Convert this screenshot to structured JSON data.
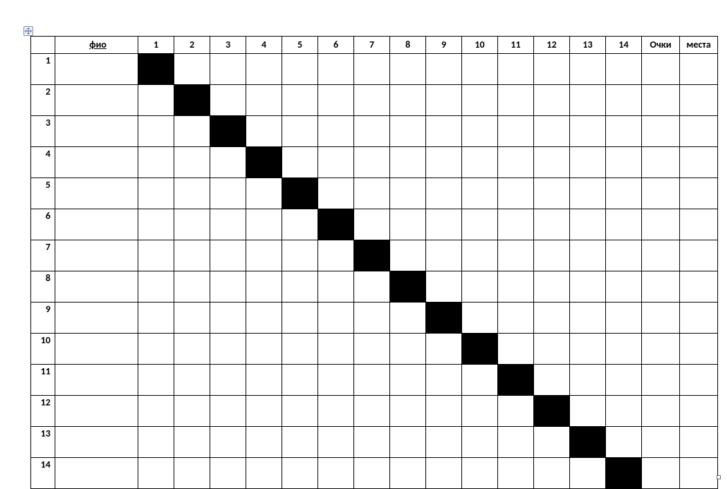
{
  "header": {
    "rownum": "",
    "name": "фио",
    "columns": [
      "1",
      "2",
      "3",
      "4",
      "5",
      "6",
      "7",
      "8",
      "9",
      "10",
      "11",
      "12",
      "13",
      "14"
    ],
    "points": "Очки",
    "place": "места"
  },
  "rows": [
    {
      "num": "1",
      "name": "",
      "cells": [
        "",
        "",
        "",
        "",
        "",
        "",
        "",
        "",
        "",
        "",
        "",
        "",
        "",
        ""
      ],
      "diag": 0,
      "points": "",
      "place": ""
    },
    {
      "num": "2",
      "name": "",
      "cells": [
        "",
        "",
        "",
        "",
        "",
        "",
        "",
        "",
        "",
        "",
        "",
        "",
        "",
        ""
      ],
      "diag": 1,
      "points": "",
      "place": ""
    },
    {
      "num": "3",
      "name": "",
      "cells": [
        "",
        "",
        "",
        "",
        "",
        "",
        "",
        "",
        "",
        "",
        "",
        "",
        "",
        ""
      ],
      "diag": 2,
      "points": "",
      "place": ""
    },
    {
      "num": "4",
      "name": "",
      "cells": [
        "",
        "",
        "",
        "",
        "",
        "",
        "",
        "",
        "",
        "",
        "",
        "",
        "",
        ""
      ],
      "diag": 3,
      "points": "",
      "place": ""
    },
    {
      "num": "5",
      "name": "",
      "cells": [
        "",
        "",
        "",
        "",
        "",
        "",
        "",
        "",
        "",
        "",
        "",
        "",
        "",
        ""
      ],
      "diag": 4,
      "points": "",
      "place": ""
    },
    {
      "num": "6",
      "name": "",
      "cells": [
        "",
        "",
        "",
        "",
        "",
        "",
        "",
        "",
        "",
        "",
        "",
        "",
        "",
        ""
      ],
      "diag": 5,
      "points": "",
      "place": ""
    },
    {
      "num": "7",
      "name": "",
      "cells": [
        "",
        "",
        "",
        "",
        "",
        "",
        "",
        "",
        "",
        "",
        "",
        "",
        "",
        ""
      ],
      "diag": 6,
      "points": "",
      "place": ""
    },
    {
      "num": "8",
      "name": "",
      "cells": [
        "",
        "",
        "",
        "",
        "",
        "",
        "",
        "",
        "",
        "",
        "",
        "",
        "",
        ""
      ],
      "diag": 7,
      "points": "",
      "place": ""
    },
    {
      "num": "9",
      "name": "",
      "cells": [
        "",
        "",
        "",
        "",
        "",
        "",
        "",
        "",
        "",
        "",
        "",
        "",
        "",
        ""
      ],
      "diag": 8,
      "points": "",
      "place": ""
    },
    {
      "num": "10",
      "name": "",
      "cells": [
        "",
        "",
        "",
        "",
        "",
        "",
        "",
        "",
        "",
        "",
        "",
        "",
        "",
        ""
      ],
      "diag": 9,
      "points": "",
      "place": ""
    },
    {
      "num": "11",
      "name": "",
      "cells": [
        "",
        "",
        "",
        "",
        "",
        "",
        "",
        "",
        "",
        "",
        "",
        "",
        "",
        ""
      ],
      "diag": 10,
      "points": "",
      "place": ""
    },
    {
      "num": "12",
      "name": "",
      "cells": [
        "",
        "",
        "",
        "",
        "",
        "",
        "",
        "",
        "",
        "",
        "",
        "",
        "",
        ""
      ],
      "diag": 11,
      "points": "",
      "place": ""
    },
    {
      "num": "13",
      "name": "",
      "cells": [
        "",
        "",
        "",
        "",
        "",
        "",
        "",
        "",
        "",
        "",
        "",
        "",
        "",
        ""
      ],
      "diag": 12,
      "points": "",
      "place": ""
    },
    {
      "num": "14",
      "name": "",
      "cells": [
        "",
        "",
        "",
        "",
        "",
        "",
        "",
        "",
        "",
        "",
        "",
        "",
        "",
        ""
      ],
      "diag": 13,
      "points": "",
      "place": ""
    }
  ]
}
